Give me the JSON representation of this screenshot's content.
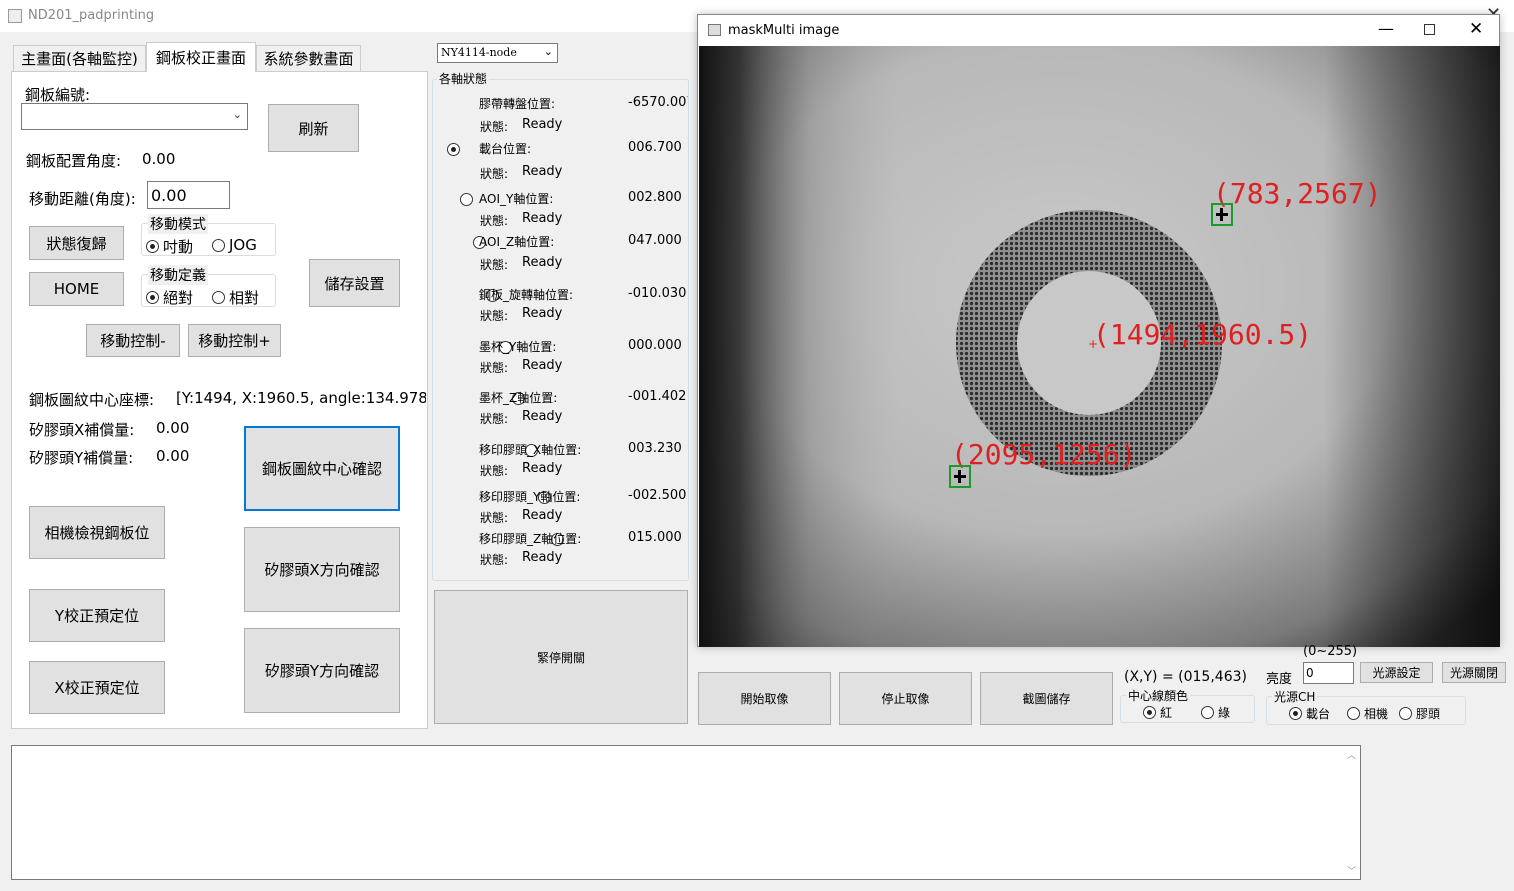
{
  "app_title": "ND201_padprinting",
  "tabs": [
    "主畫面(各軸監控)",
    "鋼板校正畫面",
    "系統參數畫面"
  ],
  "left": {
    "plate_no_label": "鋼板編號:",
    "refresh": "刷新",
    "angle_label": "鋼板配置角度:",
    "angle_value": "0.00",
    "move_dist_label": "移動距離(角度):",
    "move_dist_value": "0.00",
    "state_reset": "狀態復歸",
    "home": "HOME",
    "move_mode_title": "移動模式",
    "mode_opt1": "吋動",
    "mode_opt2": "JOG",
    "move_def_title": "移動定義",
    "def_opt1": "絕對",
    "def_opt2": "相對",
    "save_settings": "儲存設置",
    "move_minus": "移動控制-",
    "move_plus": "移動控制+",
    "center_label": "鋼板圖紋中心座標:",
    "center_value": "[Y:1494, X:1960.5, angle:134.978",
    "x_comp_label": "矽膠頭X補償量:",
    "x_comp_value": "0.00",
    "y_comp_label": "矽膠頭Y補償量:",
    "y_comp_value": "0.00",
    "confirm_center": "鋼板圖紋中心確認",
    "camera_view": "相機檢視鋼板位",
    "x_dir_confirm": "矽膠頭X方向確認",
    "y_preset": "Y校正預定位",
    "y_dir_confirm": "矽膠頭Y方向確認",
    "x_preset": "X校正預定位"
  },
  "mid": {
    "device_select": "NY4114-node",
    "axes_title": "各軸狀態",
    "state_label": "狀態:",
    "axes": [
      {
        "name": "膠帶轉盤位置:",
        "value": "-6570.007",
        "state": "Ready"
      },
      {
        "name": "載台位置:",
        "value": "006.700",
        "state": "Ready"
      },
      {
        "name": "AOI_Y軸位置:",
        "value": "002.800",
        "state": "Ready"
      },
      {
        "name": "AOI_Z軸位置:",
        "value": "047.000",
        "state": "Ready"
      },
      {
        "name": "鋼板_旋轉軸位置:",
        "value": "-010.030",
        "state": "Ready"
      },
      {
        "name": "墨杯_Y軸位置:",
        "value": "000.000",
        "state": "Ready"
      },
      {
        "name": "墨杯_Z軸位置:",
        "value": "-001.402",
        "state": "Ready"
      },
      {
        "name": "移印膠頭_X軸位置:",
        "value": "003.230",
        "state": "Ready"
      },
      {
        "name": "移印膠頭_Y軸位置:",
        "value": "-002.500",
        "state": "Ready"
      },
      {
        "name": "移印膠頭_Z軸位置:",
        "value": "015.000",
        "state": "Ready"
      }
    ],
    "estop": "緊停開關"
  },
  "image_window": {
    "title": "maskMulti image",
    "label1": "(783,2567)",
    "label2": "(1494,1960.5)",
    "label3": "(2095,1256)"
  },
  "bottom": {
    "start_capture": "開始取像",
    "stop_capture": "停止取像",
    "save_capture": "截圖儲存",
    "xy_readout": "(X,Y) = (015,463)",
    "line_color_title": "中心線顏色",
    "color_red": "紅",
    "color_green": "綠",
    "range_hint": "(0~255)",
    "brightness_label": "亮度",
    "brightness_value": "0",
    "light_set": "光源設定",
    "light_off": "光源關閉",
    "light_ch_title": "光源CH",
    "ch1": "載台",
    "ch2": "相機",
    "ch3": "膠頭"
  },
  "colors": {
    "accent_border": "#0078d7",
    "overlay_red": "#e02020",
    "marker_green": "#1a9a2a"
  }
}
